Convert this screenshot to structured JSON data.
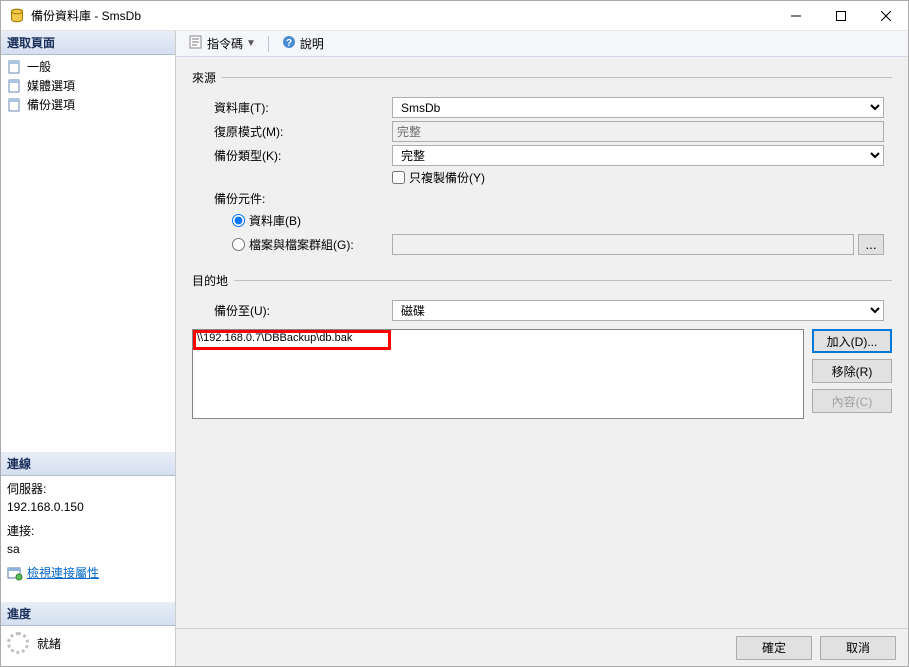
{
  "window": {
    "title": "備份資料庫 - SmsDb"
  },
  "sidebar": {
    "header_pages": "選取頁面",
    "pages": {
      "general": "一般",
      "media": "媒體選項",
      "backup": "備份選項"
    },
    "header_conn": "連線",
    "conn": {
      "server_label": "伺服器:",
      "server_value": "192.168.0.150",
      "connection_label": "連接:",
      "connection_value": "sa",
      "view_props": "檢視連接屬性"
    },
    "header_progress": "進度",
    "progress": {
      "status": "就緒"
    }
  },
  "toolbar": {
    "script": "指令碼",
    "help": "說明"
  },
  "form": {
    "source_legend": "來源",
    "database_label": "資料庫(T):",
    "database_value": "SmsDb",
    "recovery_label": "復原模式(M):",
    "recovery_value": "完整",
    "type_label": "備份類型(K):",
    "type_value": "完整",
    "copy_only": "只複製備份(Y)",
    "component_label": "備份元件:",
    "component_db": "資料庫(B)",
    "component_files": "檔案與檔案群組(G):",
    "dest_legend": "目的地",
    "backup_to_label": "備份至(U):",
    "backup_to_value": "磁碟",
    "dest_item": "\\\\192.168.0.7\\DBBackup\\db.bak",
    "add_btn": "加入(D)...",
    "remove_btn": "移除(R)",
    "contents_btn": "內容(C)"
  },
  "footer": {
    "ok": "確定",
    "cancel": "取消"
  }
}
